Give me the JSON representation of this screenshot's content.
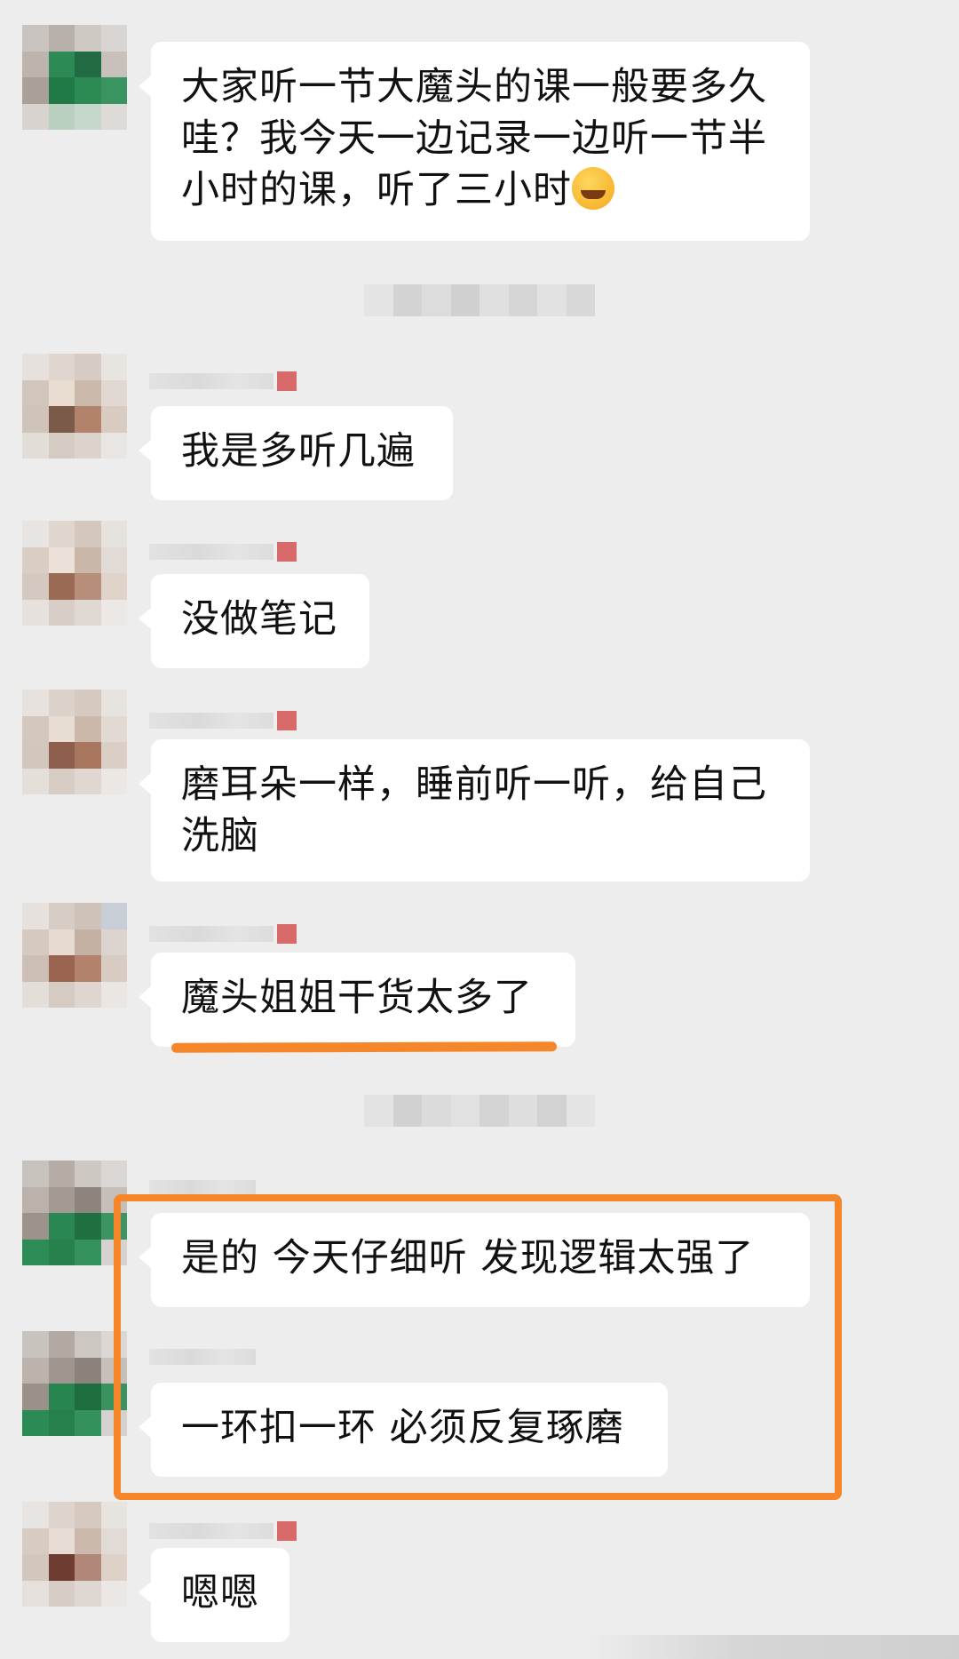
{
  "chat": {
    "messages": [
      {
        "id": "m1",
        "text_lines": [
          "大家听一节大魔头的课一般要多久",
          "哇？我今天一边记录一边听一节半",
          "小时的课，听了三小时"
        ],
        "emoji": "face-palm-laughing-emoji"
      },
      {
        "id": "m2",
        "text": "我是多听几遍"
      },
      {
        "id": "m3",
        "text": "没做笔记"
      },
      {
        "id": "m4",
        "text_lines": [
          "磨耳朵一样，睡前听一听，给自己",
          "洗脑"
        ]
      },
      {
        "id": "m5",
        "text": "魔头姐姐干货太多了"
      },
      {
        "id": "m6",
        "text": "是的 今天仔细听 发现逻辑太强了"
      },
      {
        "id": "m7",
        "text": "一环扣一环 必须反复琢磨"
      },
      {
        "id": "m8",
        "text": "嗯嗯"
      }
    ]
  },
  "colors": {
    "background": "#ededed",
    "bubble": "#ffffff",
    "highlight": "#f5872a"
  },
  "icons": {
    "avatar": "pixelated-avatar",
    "emoji": "face-palm-laughing-emoji"
  }
}
